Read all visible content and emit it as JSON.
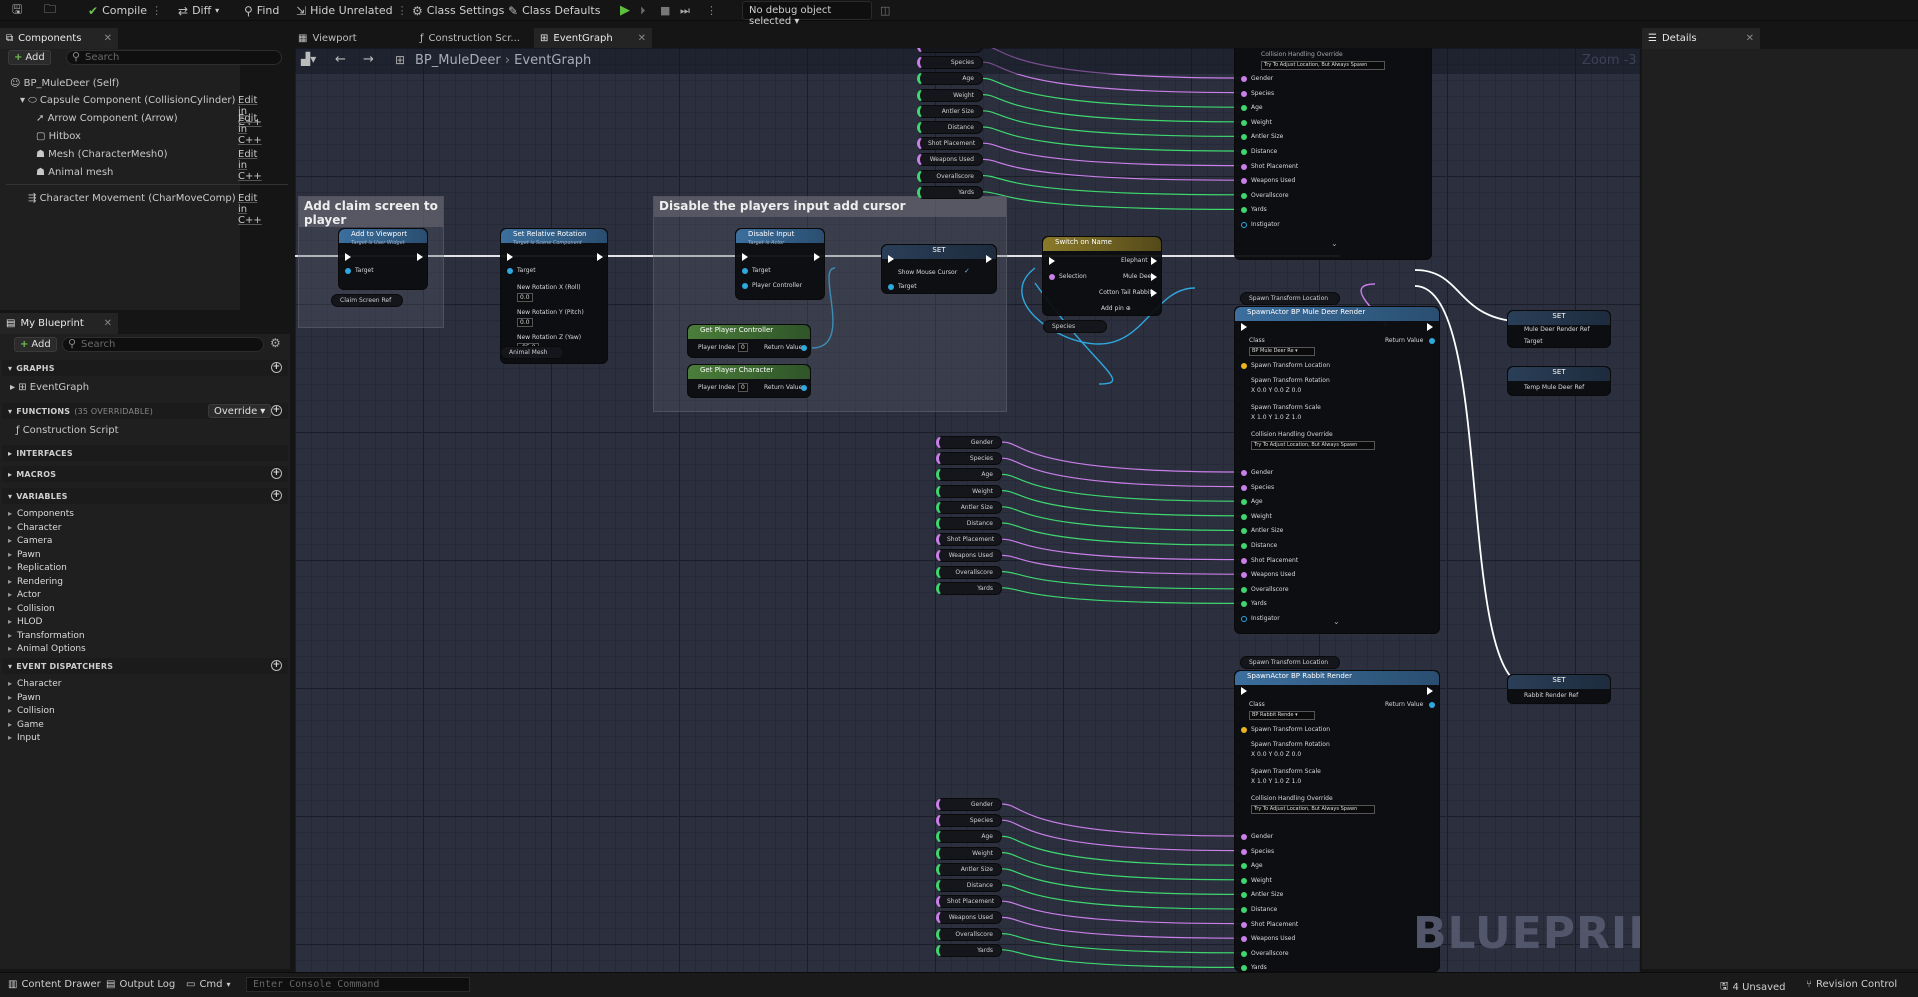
{
  "toolbar": {
    "compile": "Compile",
    "diff": "Diff",
    "find": "Find",
    "hide_unrelated": "Hide Unrelated",
    "class_settings": "Class Settings",
    "class_defaults": "Class Defaults",
    "debug_object": "No debug object selected"
  },
  "components_panel": {
    "title": "Components",
    "add": "Add",
    "search_placeholder": "Search",
    "items": [
      {
        "label": "BP_MuleDeer (Self)"
      },
      {
        "label": "Capsule Component (CollisionCylinder)",
        "edit": "Edit in C++"
      },
      {
        "label": "Arrow Component (Arrow)",
        "edit": "Edit in C++"
      },
      {
        "label": "Hitbox"
      },
      {
        "label": "Mesh (CharacterMesh0)",
        "edit": "Edit in C++"
      },
      {
        "label": "Animal mesh"
      },
      {
        "label": "Character Movement (CharMoveComp)",
        "edit": "Edit in C++"
      }
    ]
  },
  "my_blueprint": {
    "title": "My Blueprint",
    "add": "Add",
    "search_placeholder": "Search",
    "graphs": "GRAPHS",
    "event_graph": "EventGraph",
    "functions": "FUNCTIONS",
    "functions_count": "(35 OVERRIDABLE)",
    "override": "Override",
    "construction_script": "Construction Script",
    "interfaces": "INTERFACES",
    "macros": "MACROS",
    "variables": "VARIABLES",
    "variable_categories": [
      "Components",
      "Character",
      "Camera",
      "Pawn",
      "Replication",
      "Rendering",
      "Actor",
      "Collision",
      "HLOD",
      "Transformation",
      "Animal Options"
    ],
    "event_dispatchers": "EVENT DISPATCHERS",
    "dispatcher_categories": [
      "Character",
      "Pawn",
      "Collision",
      "Game",
      "Input"
    ]
  },
  "tabs": {
    "viewport": "Viewport",
    "construction": "Construction Scr...",
    "event_graph": "EventGraph",
    "details": "Details"
  },
  "graph": {
    "breadcrumb_bp": "BP_MuleDeer",
    "breadcrumb_graph": "EventGraph",
    "zoom": "Zoom -3",
    "watermark": "BLUEPRINT",
    "comment1": "Add claim screen to player",
    "comment2": "Disable the players input add cursor",
    "n_add_viewport": "Add to Viewport",
    "n_add_viewport_sub": "Target is User Widget",
    "n_set_rot": "Set Relative Rotation",
    "n_set_rot_sub": "Target is Scene Component",
    "n_disable_input": "Disable Input",
    "n_disable_input_sub": "Target is Actor",
    "n_set": "SET",
    "show_mouse_cursor": "Show Mouse Cursor",
    "n_get_pc": "Get Player Controller",
    "n_get_char": "Get Player Character",
    "player_index": "Player Index",
    "return_value": "Return Value",
    "n_switch": "Switch on Name",
    "elephant": "Elephant",
    "mule_deer": "Mule Deer",
    "cotton_tail": "Cotton Tail Rabbit",
    "selection": "Selection",
    "add_pin": "Add pin",
    "target": "Target",
    "player_controller": "Player Controller",
    "new_rot_x": "New Rotation X (Roll)",
    "new_rot_y": "New Rotation Y (Pitch)",
    "new_rot_z": "New Rotation Z (Yaw)",
    "rot_x_val": "0.0",
    "rot_y_val": "0.0",
    "rot_z_val": "-85.0",
    "claim_screen_ref": "Claim Screen Ref",
    "animal_mesh": "Animal Mesh",
    "species": "Species",
    "spawn_mule": "SpawnActor BP Mule Deer Render",
    "spawn_rabbit": "SpawnActor BP Rabbit Render",
    "spawn_transform_location": "Spawn Transform Location",
    "class": "Class",
    "class_mule": "BP Mule Deer Re",
    "class_rabbit": "BP Rabbit Rende",
    "spawn_transform_rotation": "Spawn Transform Rotation",
    "spawn_transform_scale": "Spawn Transform Scale",
    "collision_override": "Collision Handling Override",
    "collision_value": "Try To Adjust Location, But Always Spawn",
    "mule_ref": "Mule Deer Render Ref",
    "temp_mule_ref": "Temp Mule Deer Ref",
    "rabbit_ref": "Rabbit Render Ref",
    "instigator": "Instigator",
    "spawn_pins": [
      "Gender",
      "Species",
      "Age",
      "Weight",
      "Antler Size",
      "Distance",
      "Shot Placement",
      "Weapons Used",
      "Overallscore",
      "Yards"
    ],
    "var_pills": [
      "Gender",
      "Species",
      "Age",
      "Weight",
      "Antler Size",
      "Distance",
      "Shot Placement",
      "Weapons Used",
      "Overallscore",
      "Yards"
    ],
    "rot_vals": [
      "0.0",
      "0.0",
      "0.0"
    ],
    "scale_vals": [
      "1.0",
      "1.0",
      "1.0"
    ],
    "axis_labels": [
      "X",
      "Y",
      "Z"
    ]
  },
  "status": {
    "content_drawer": "Content Drawer",
    "output_log": "Output Log",
    "cmd": "Cmd",
    "console_placeholder": "Enter Console Command",
    "unsaved": "4 Unsaved",
    "revision": "Revision Control"
  }
}
